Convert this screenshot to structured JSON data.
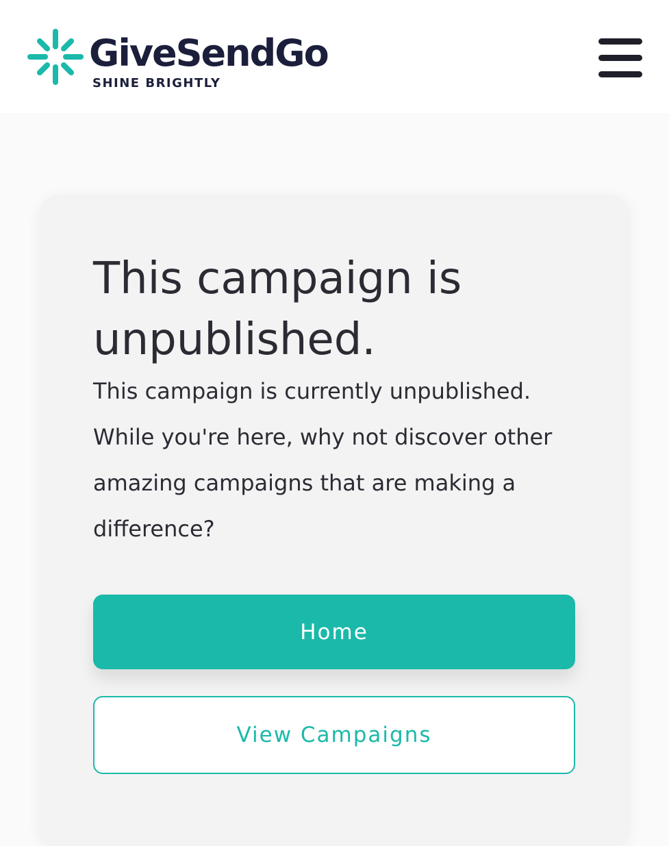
{
  "header": {
    "brand_name": "GiveSendGo",
    "tagline": "SHINE BRIGHTLY",
    "logo_icon": "sparkle-logo-icon",
    "menu_icon": "hamburger-menu-icon"
  },
  "card": {
    "title": "This campaign is unpublished.",
    "message": "This campaign is currently unpublished. While you're here, why not discover other amazing campaigns that are making a difference?",
    "primary_button_label": "Home",
    "secondary_button_label": "View Campaigns"
  },
  "colors": {
    "brand_teal": "#1bb9a9",
    "brand_navy": "#1b1f3b",
    "text_dark": "#2b2b33",
    "card_background": "#f3f3f4",
    "page_background": "#fafafa"
  }
}
